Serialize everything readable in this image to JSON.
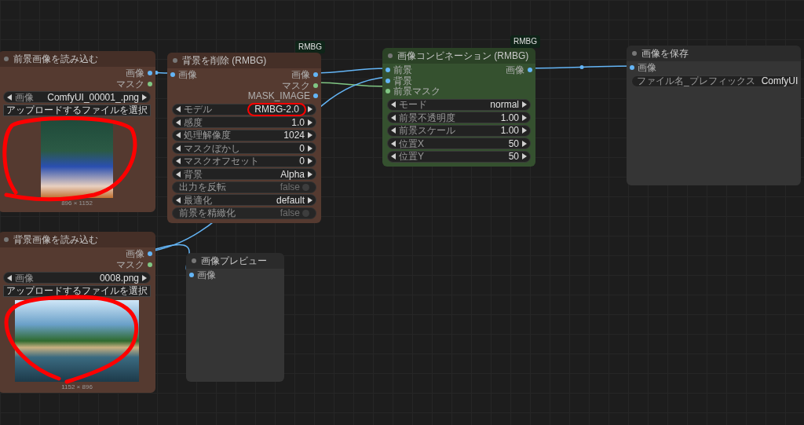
{
  "nodes": [
    {
      "title": "前景画像を読み込む",
      "color": "#553a30",
      "outputs": [
        {
          "label": "画像",
          "color": "#64b5f6"
        },
        {
          "label": "マスク",
          "color": "#81c784"
        }
      ],
      "widgets": [
        {
          "kind": "combo",
          "label": "画像",
          "value": "ComfyUI_00001_.png"
        },
        {
          "kind": "button",
          "label": "アップロードするファイルを選択"
        },
        {
          "kind": "image",
          "caption": "896 × 1152"
        }
      ]
    },
    {
      "title": "背景を削除 (RMBG)",
      "badge": "RMBG",
      "color": "#553a30",
      "inputs": [
        {
          "label": "画像",
          "color": "#64b5f6"
        }
      ],
      "outputs": [
        {
          "label": "画像",
          "color": "#64b5f6"
        },
        {
          "label": "マスク",
          "color": "#81c784"
        },
        {
          "label": "MASK_IMAGE",
          "color": "#64b5f6"
        }
      ],
      "widgets": [
        {
          "kind": "combo",
          "label": "モデル",
          "value": "RMBG-2.0",
          "marked": true
        },
        {
          "kind": "combo",
          "label": "感度",
          "value": "1.0"
        },
        {
          "kind": "combo",
          "label": "処理解像度",
          "value": "1024"
        },
        {
          "kind": "combo",
          "label": "マスクぼかし",
          "value": "0"
        },
        {
          "kind": "combo",
          "label": "マスクオフセット",
          "value": "0"
        },
        {
          "kind": "combo",
          "label": "背景",
          "value": "Alpha"
        },
        {
          "kind": "toggle",
          "label": "出力を反転",
          "value": "false",
          "on": false
        },
        {
          "kind": "combo",
          "label": "最適化",
          "value": "default"
        },
        {
          "kind": "toggle",
          "label": "前景を精緻化",
          "value": "false",
          "on": false
        }
      ]
    },
    {
      "title": "画像コンビネーション (RMBG)",
      "badge": "RMBG",
      "color": "#35512f",
      "inputs": [
        {
          "label": "前景",
          "color": "#64b5f6"
        },
        {
          "label": "背景",
          "color": "#64b5f6"
        },
        {
          "label": "前景マスク",
          "color": "#81c784"
        }
      ],
      "outputs": [
        {
          "label": "画像",
          "color": "#64b5f6"
        }
      ],
      "widgets": [
        {
          "kind": "combo",
          "label": "モード",
          "value": "normal"
        },
        {
          "kind": "combo",
          "label": "前景不透明度",
          "value": "1.00"
        },
        {
          "kind": "combo",
          "label": "前景スケール",
          "value": "1.00"
        },
        {
          "kind": "combo",
          "label": "位置X",
          "value": "50"
        },
        {
          "kind": "combo",
          "label": "位置Y",
          "value": "50"
        }
      ]
    },
    {
      "title": "画像を保存",
      "color": "#353535",
      "inputs": [
        {
          "label": "画像",
          "color": "#64b5f6"
        }
      ],
      "widgets": [
        {
          "kind": "text",
          "label": "ファイル名_プレフィックス",
          "value": "ComfyUI"
        }
      ]
    },
    {
      "title": "背景画像を読み込む",
      "color": "#553a30",
      "outputs": [
        {
          "label": "画像",
          "color": "#64b5f6"
        },
        {
          "label": "マスク",
          "color": "#81c784"
        }
      ],
      "widgets": [
        {
          "kind": "combo",
          "label": "画像",
          "value": "0008.png"
        },
        {
          "kind": "button",
          "label": "アップロードするファイルを選択"
        },
        {
          "kind": "image",
          "caption": "1152 × 896"
        }
      ]
    },
    {
      "title": "画像プレビュー",
      "color": "#353535",
      "inputs": [
        {
          "label": "画像",
          "color": "#64b5f6"
        }
      ]
    }
  ]
}
